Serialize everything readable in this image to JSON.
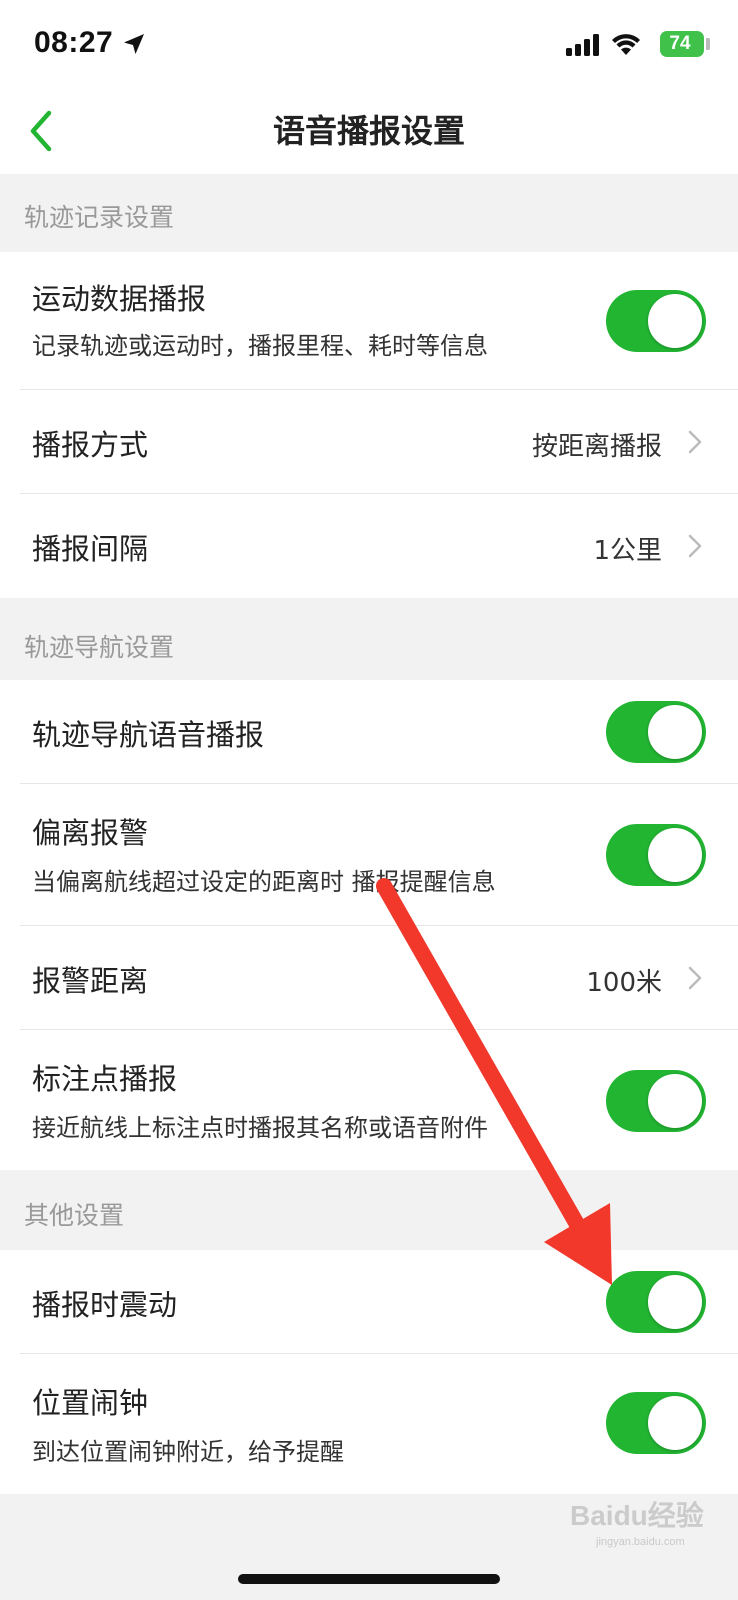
{
  "status_bar": {
    "time": "08:27",
    "battery": "74"
  },
  "nav": {
    "title": "语音播报设置"
  },
  "sections": [
    {
      "header": "轨迹记录设置",
      "rows": [
        {
          "title": "运动数据播报",
          "subtitle": "记录轨迹或运动时，播报里程、耗时等信息",
          "toggle_on": true
        },
        {
          "title": "播报方式",
          "value": "按距离播报"
        },
        {
          "title": "播报间隔",
          "value": "1公里"
        }
      ]
    },
    {
      "header": "轨迹导航设置",
      "rows": [
        {
          "title": "轨迹导航语音播报",
          "toggle_on": true
        },
        {
          "title": "偏离报警",
          "subtitle": "当偏离航线超过设定的距离时 播报提醒信息",
          "toggle_on": true
        },
        {
          "title": "报警距离",
          "value": "100米"
        },
        {
          "title": "标注点播报",
          "subtitle": "接近航线上标注点时播报其名称或语音附件",
          "toggle_on": true
        }
      ]
    },
    {
      "header": "其他设置",
      "rows": [
        {
          "title": "播报时震动",
          "toggle_on": true
        },
        {
          "title": "位置闹钟",
          "subtitle": "到达位置闹钟附近，给予提醒",
          "toggle_on": true
        }
      ]
    }
  ],
  "watermark": {
    "brand": "Baidu经验",
    "url": "jingyan.baidu.com"
  },
  "colors": {
    "accent": "#22b532",
    "back_arrow": "#22b532",
    "annotation_arrow": "#f2372b"
  }
}
